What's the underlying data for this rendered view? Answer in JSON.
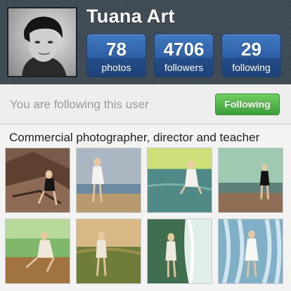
{
  "profile": {
    "username": "Tuana Art",
    "avatar_icon": "user-avatar-photo"
  },
  "stats": [
    {
      "value": "78",
      "label": "photos"
    },
    {
      "value": "4706",
      "label": "followers"
    },
    {
      "value": "29",
      "label": "following"
    }
  ],
  "follow": {
    "status_text": "You are following this user",
    "button_label": "Following",
    "button_color": "#4caf3f"
  },
  "bio": "Commercial photographer, director and teacher",
  "colors": {
    "header_bg": "#3f4b55",
    "stat_blue": "#2f5fa5"
  },
  "photos": [
    {
      "name": "rock-cliff-seated-woman"
    },
    {
      "name": "beach-white-dress-woman"
    },
    {
      "name": "wading-water-woman"
    },
    {
      "name": "shore-black-dress-woman"
    },
    {
      "name": "green-field-sitting-woman"
    },
    {
      "name": "sunset-meadow-woman"
    },
    {
      "name": "waterfall-woman-left"
    },
    {
      "name": "waterfall-white-dress-woman"
    }
  ]
}
